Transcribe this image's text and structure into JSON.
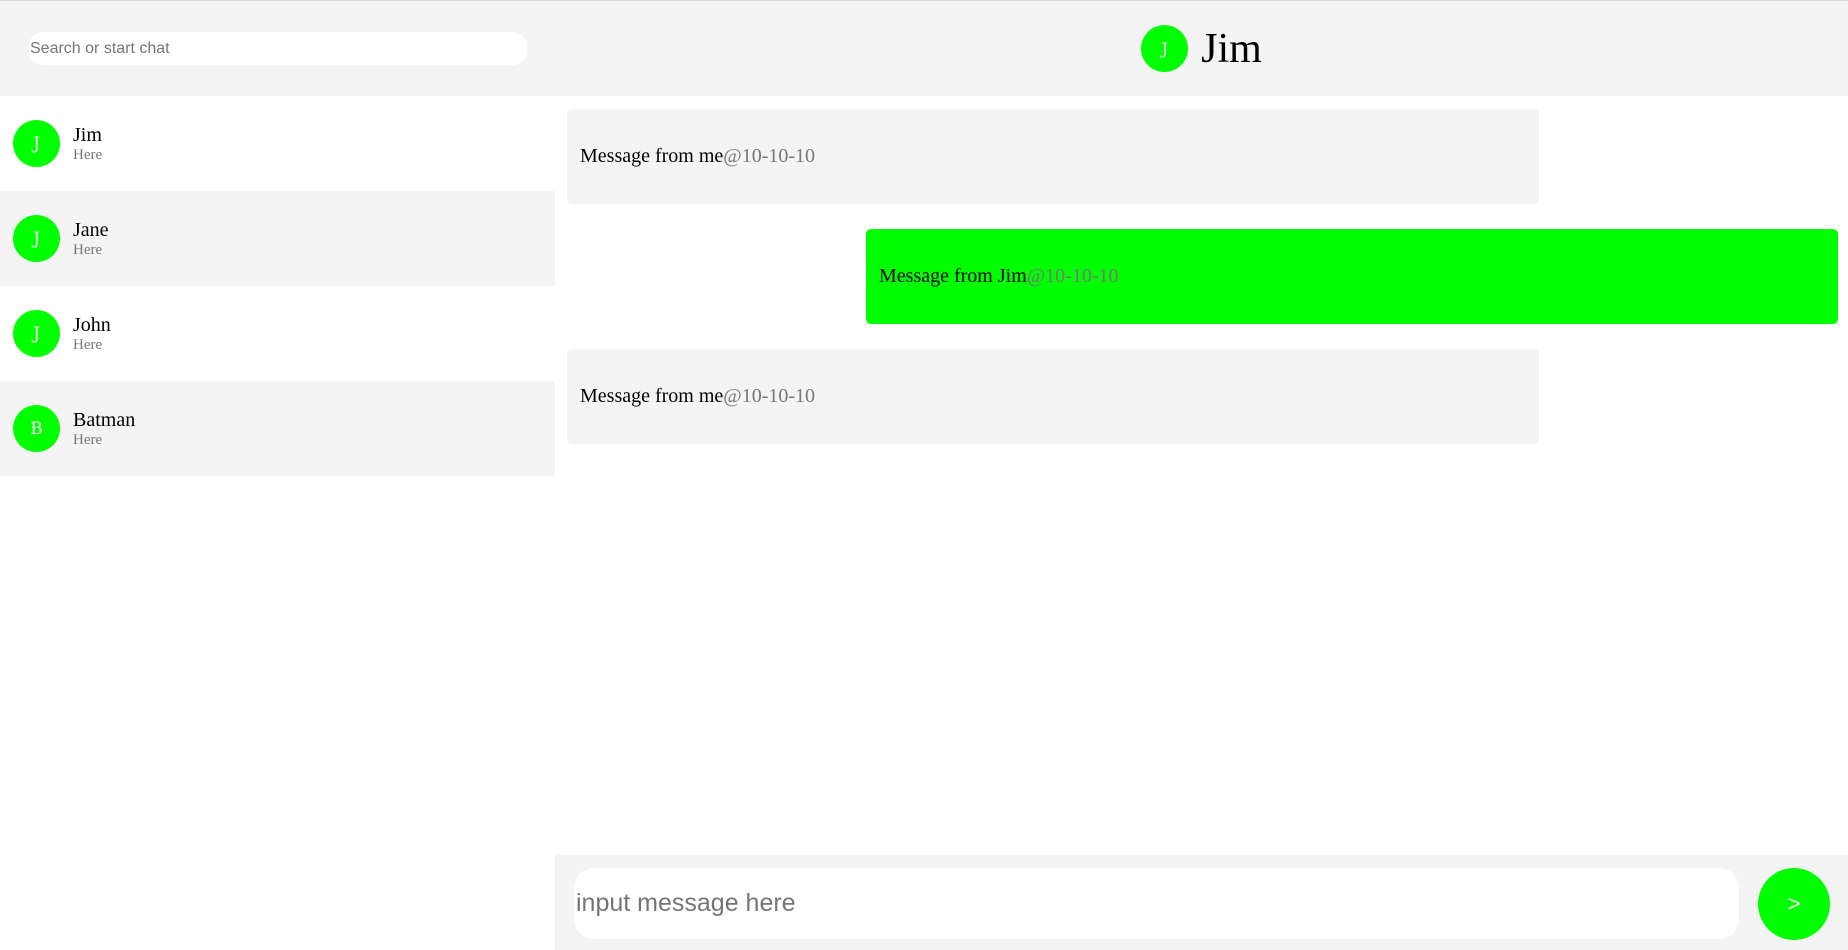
{
  "sidebar": {
    "search": {
      "placeholder": "Search or start chat",
      "value": ""
    },
    "contacts": [
      {
        "initial": "J",
        "name": "Jim",
        "status": "Here"
      },
      {
        "initial": "J",
        "name": "Jane",
        "status": "Here"
      },
      {
        "initial": "J",
        "name": "John",
        "status": "Here"
      },
      {
        "initial": "B",
        "name": "Batman",
        "status": "Here"
      }
    ]
  },
  "chat": {
    "header": {
      "initial": "J",
      "name": "Jim"
    },
    "messages": [
      {
        "text": "Message from me",
        "time": "@10-10-10",
        "from": "me"
      },
      {
        "text": "Message from Jim",
        "time": "@10-10-10",
        "from": "Jim"
      },
      {
        "text": "Message from me",
        "time": "@10-10-10",
        "from": "me"
      }
    ],
    "composer": {
      "placeholder": "input message here",
      "value": "",
      "send_label": ">"
    }
  },
  "colors": {
    "accent": "#00ff00",
    "panel": "#f4f4f4",
    "muted_text": "#777777"
  }
}
